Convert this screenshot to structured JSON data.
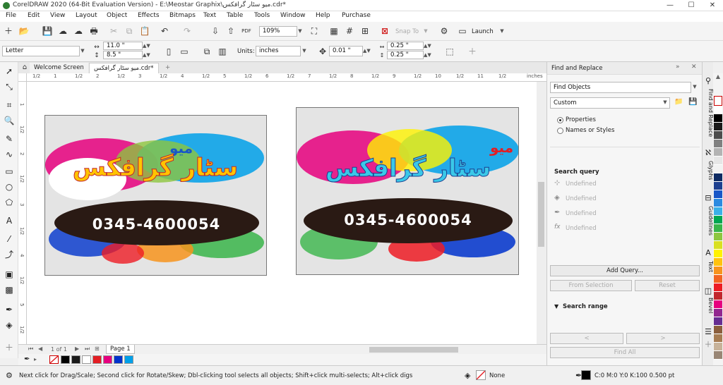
{
  "app": {
    "title": "CorelDRAW 2020 (64-Bit Evaluation Version) - E:\\Meostar Graphix\\میو سٹار گرافکس.cdr*",
    "win_min": "—",
    "win_max": "☐",
    "win_close": "✕"
  },
  "menu": [
    "File",
    "Edit",
    "View",
    "Layout",
    "Object",
    "Effects",
    "Bitmaps",
    "Text",
    "Table",
    "Tools",
    "Window",
    "Help",
    "Purchase"
  ],
  "toolbar1": {
    "zoom": "109%",
    "snap_label": "Snap To",
    "launch_label": "Launch"
  },
  "toolbar2": {
    "paper": "Letter",
    "width": "11.0 \"",
    "height": "8.5 \"",
    "units_label": "Units:",
    "units": "inches",
    "nudge": "0.01 \"",
    "dup_x": "0.25 \"",
    "dup_y": "0.25 \""
  },
  "tabs": {
    "welcome": "Welcome Screen",
    "doc": "میو سٹار گرافکس.cdr*",
    "add": "+"
  },
  "ruler": {
    "h_labels": [
      "1/2",
      "1",
      "1/2",
      "2",
      "1/2",
      "3",
      "1/2",
      "4",
      "1/2",
      "5",
      "1/2",
      "6",
      "1/2",
      "7",
      "1/2",
      "8",
      "1/2",
      "9",
      "1/2",
      "10",
      "1/2",
      "11",
      "1/2",
      "12"
    ],
    "units": "inches",
    "v_labels": [
      "1",
      "1/2",
      "2",
      "1/2",
      "3",
      "1/2",
      "4",
      "1/2",
      "5",
      "1/2"
    ]
  },
  "banner": {
    "small": "میو",
    "large": "سٹار گرافکس",
    "phone": "0345-4600054"
  },
  "pagenav": {
    "count": "1 of 1",
    "page_tab": "Page 1"
  },
  "palette_bottom": [
    "#000000",
    "#1a1a1a",
    "#ffffff",
    "#e31e24",
    "#e6007e",
    "#0033cc",
    "#00a0e9"
  ],
  "status": {
    "hint": "Next click for Drag/Scale; Second click for Rotate/Skew; Dbl-clicking tool selects all objects; Shift+click multi-selects; Alt+click digs",
    "fill": "None",
    "outline": "C:0 M:0 Y:0 K:100  0.500 pt"
  },
  "docker": {
    "title": "Find and Replace",
    "mode": "Find Objects",
    "preset": "Custom",
    "opt_properties": "Properties",
    "opt_names": "Names or Styles",
    "search_query": "Search query",
    "undefined": [
      "Undefined",
      "Undefined",
      "Undefined",
      "Undefined"
    ],
    "add_query": "Add Query...",
    "from_selection": "From Selection",
    "reset": "Reset",
    "search_range": "Search range",
    "prev": "<",
    "next": ">",
    "find_all": "Find All"
  },
  "sidetabs": [
    "Find and Replace",
    "Glyphs",
    "Guidelines",
    "Text",
    "Bevel"
  ],
  "palette_right": [
    "#ffffff",
    "#000000",
    "#1a1a1a",
    "#4d4d4d",
    "#808080",
    "#b3b3b3",
    "#e6e6e6",
    "#f2f2f2",
    "#0e2b63",
    "#1d3f8f",
    "#1957c7",
    "#2b8ae0",
    "#3ab0e8",
    "#00a651",
    "#39b54a",
    "#8dc63f",
    "#d9e021",
    "#fff200",
    "#ffc20e",
    "#f7941d",
    "#f26522",
    "#ed1c24",
    "#c1272d",
    "#e6007e",
    "#92278f",
    "#662d91",
    "#8b5e3c",
    "#a67c52",
    "#c7b299",
    "#998675"
  ],
  "colors": {
    "yellow": "#ffc400",
    "red": "#e31e24",
    "cyan": "#3ac8e8",
    "dark": "#2a1a14"
  }
}
